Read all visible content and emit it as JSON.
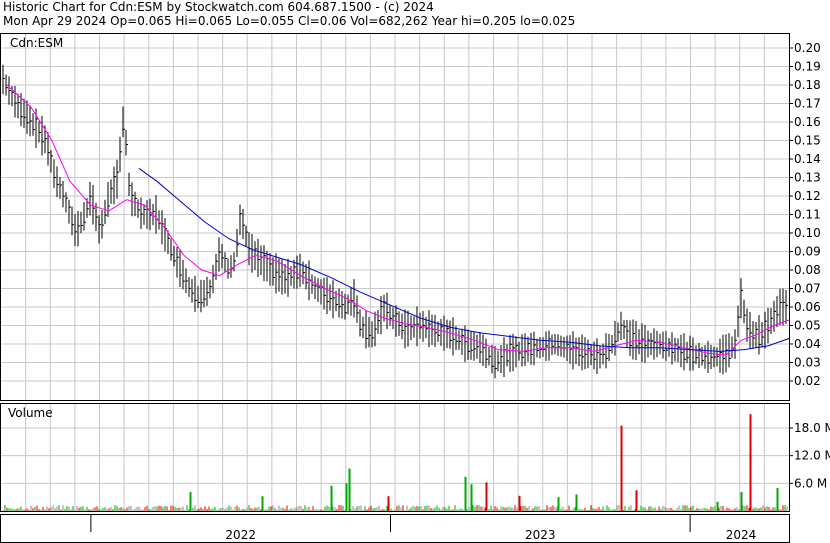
{
  "header": {
    "line1": "Historic Chart for Cdn:ESM by Stockwatch.com 604.687.1500 - (c) 2024",
    "line2": "Mon Apr 29 2024   Op=0.065   Hi=0.065   Lo=0.055   Cl=0.06   Vol=682,262   Year hi=0.205   lo=0.025"
  },
  "colors": {
    "price_bar": "#000000",
    "ma_short": "#ff00ff",
    "ma_long": "#0000cc",
    "volume_up": "#00aa00",
    "volume_down": "#dd0000",
    "volume_flat": "#888888",
    "grid": "#c8c8c8"
  },
  "chart_data": [
    {
      "type": "ohlc",
      "label": "Cdn:ESM",
      "y_ticks": [
        "0.20",
        "0.19",
        "0.18",
        "0.17",
        "0.16",
        "0.15",
        "0.14",
        "0.13",
        "0.12",
        "0.11",
        "0.10",
        "0.09",
        "0.08",
        "0.07",
        "0.06",
        "0.05",
        "0.04",
        "0.03",
        "0.02"
      ],
      "ylim": [
        0.01,
        0.205
      ],
      "x_ticks": [
        "2022",
        "2023",
        "2024"
      ],
      "x_tick_positions": [
        2022.5,
        2023.5,
        2024.17
      ],
      "xlim": [
        2021.7,
        2024.33
      ],
      "price_points": [
        [
          2021.7,
          0.185
        ],
        [
          2021.75,
          0.17
        ],
        [
          2021.8,
          0.16
        ],
        [
          2021.85,
          0.15
        ],
        [
          2021.88,
          0.13
        ],
        [
          2021.91,
          0.12
        ],
        [
          2021.95,
          0.1
        ],
        [
          2021.98,
          0.11
        ],
        [
          2022.0,
          0.12
        ],
        [
          2022.03,
          0.1
        ],
        [
          2022.06,
          0.12
        ],
        [
          2022.09,
          0.13
        ],
        [
          2022.11,
          0.165
        ],
        [
          2022.13,
          0.12
        ],
        [
          2022.17,
          0.11
        ],
        [
          2022.22,
          0.11
        ],
        [
          2022.27,
          0.09
        ],
        [
          2022.3,
          0.08
        ],
        [
          2022.33,
          0.07
        ],
        [
          2022.36,
          0.065
        ],
        [
          2022.4,
          0.07
        ],
        [
          2022.43,
          0.09
        ],
        [
          2022.46,
          0.08
        ],
        [
          2022.48,
          0.085
        ],
        [
          2022.5,
          0.11
        ],
        [
          2022.53,
          0.09
        ],
        [
          2022.57,
          0.085
        ],
        [
          2022.6,
          0.08
        ],
        [
          2022.65,
          0.075
        ],
        [
          2022.7,
          0.08
        ],
        [
          2022.75,
          0.07
        ],
        [
          2022.8,
          0.065
        ],
        [
          2022.85,
          0.06
        ],
        [
          2022.88,
          0.065
        ],
        [
          2022.9,
          0.05
        ],
        [
          2022.94,
          0.045
        ],
        [
          2022.98,
          0.06
        ],
        [
          2023.0,
          0.055
        ],
        [
          2023.05,
          0.048
        ],
        [
          2023.1,
          0.05
        ],
        [
          2023.15,
          0.047
        ],
        [
          2023.2,
          0.045
        ],
        [
          2023.25,
          0.04
        ],
        [
          2023.3,
          0.038
        ],
        [
          2023.35,
          0.03
        ],
        [
          2023.4,
          0.035
        ],
        [
          2023.45,
          0.037
        ],
        [
          2023.5,
          0.038
        ],
        [
          2023.55,
          0.04
        ],
        [
          2023.6,
          0.037
        ],
        [
          2023.65,
          0.035
        ],
        [
          2023.7,
          0.033
        ],
        [
          2023.74,
          0.04
        ],
        [
          2023.77,
          0.05
        ],
        [
          2023.8,
          0.043
        ],
        [
          2023.85,
          0.04
        ],
        [
          2023.9,
          0.04
        ],
        [
          2023.95,
          0.037
        ],
        [
          2024.0,
          0.035
        ],
        [
          2024.05,
          0.033
        ],
        [
          2024.09,
          0.033
        ],
        [
          2024.12,
          0.035
        ],
        [
          2024.15,
          0.04
        ],
        [
          2024.17,
          0.065
        ],
        [
          2024.19,
          0.05
        ],
        [
          2024.21,
          0.045
        ],
        [
          2024.24,
          0.045
        ],
        [
          2024.26,
          0.05
        ],
        [
          2024.28,
          0.055
        ],
        [
          2024.3,
          0.06
        ],
        [
          2024.33,
          0.06
        ]
      ],
      "series": [
        {
          "name": "short moving average",
          "points": [
            [
              2021.72,
              0.18
            ],
            [
              2021.8,
              0.168
            ],
            [
              2021.87,
              0.15
            ],
            [
              2021.93,
              0.128
            ],
            [
              2022.0,
              0.115
            ],
            [
              2022.06,
              0.112
            ],
            [
              2022.12,
              0.118
            ],
            [
              2022.18,
              0.115
            ],
            [
              2022.25,
              0.102
            ],
            [
              2022.31,
              0.088
            ],
            [
              2022.37,
              0.08
            ],
            [
              2022.43,
              0.077
            ],
            [
              2022.49,
              0.083
            ],
            [
              2022.55,
              0.088
            ],
            [
              2022.62,
              0.085
            ],
            [
              2022.7,
              0.077
            ],
            [
              2022.78,
              0.07
            ],
            [
              2022.85,
              0.065
            ],
            [
              2022.92,
              0.058
            ],
            [
              2022.98,
              0.054
            ],
            [
              2023.05,
              0.051
            ],
            [
              2023.12,
              0.049
            ],
            [
              2023.2,
              0.046
            ],
            [
              2023.28,
              0.042
            ],
            [
              2023.36,
              0.037
            ],
            [
              2023.44,
              0.036
            ],
            [
              2023.52,
              0.038
            ],
            [
              2023.6,
              0.038
            ],
            [
              2023.68,
              0.036
            ],
            [
              2023.75,
              0.039
            ],
            [
              2023.82,
              0.042
            ],
            [
              2023.9,
              0.041
            ],
            [
              2023.98,
              0.038
            ],
            [
              2024.06,
              0.035
            ],
            [
              2024.12,
              0.034
            ],
            [
              2024.17,
              0.042
            ],
            [
              2024.22,
              0.045
            ],
            [
              2024.28,
              0.05
            ],
            [
              2024.33,
              0.053
            ]
          ]
        },
        {
          "name": "long moving average",
          "points": [
            [
              2022.16,
              0.135
            ],
            [
              2022.22,
              0.128
            ],
            [
              2022.3,
              0.117
            ],
            [
              2022.38,
              0.106
            ],
            [
              2022.46,
              0.097
            ],
            [
              2022.54,
              0.091
            ],
            [
              2022.62,
              0.087
            ],
            [
              2022.7,
              0.083
            ],
            [
              2022.8,
              0.076
            ],
            [
              2022.9,
              0.068
            ],
            [
              2023.0,
              0.061
            ],
            [
              2023.1,
              0.054
            ],
            [
              2023.2,
              0.049
            ],
            [
              2023.3,
              0.046
            ],
            [
              2023.4,
              0.044
            ],
            [
              2023.5,
              0.042
            ],
            [
              2023.6,
              0.041
            ],
            [
              2023.7,
              0.039
            ],
            [
              2023.8,
              0.038
            ],
            [
              2023.9,
              0.038
            ],
            [
              2024.0,
              0.037
            ],
            [
              2024.1,
              0.036
            ],
            [
              2024.18,
              0.037
            ],
            [
              2024.26,
              0.039
            ],
            [
              2024.33,
              0.043
            ]
          ]
        }
      ]
    },
    {
      "type": "bar",
      "label": "Volume",
      "y_ticks": [
        "18.0 M",
        "12.0 M",
        "6.0 M"
      ],
      "ylim": [
        0,
        22
      ],
      "spikes": [
        {
          "x": 2022.33,
          "v": 4.1,
          "dir": "up"
        },
        {
          "x": 2022.57,
          "v": 3.2,
          "dir": "up"
        },
        {
          "x": 2022.8,
          "v": 5.5,
          "dir": "up"
        },
        {
          "x": 2022.85,
          "v": 6.0,
          "dir": "up"
        },
        {
          "x": 2022.86,
          "v": 9.2,
          "dir": "up"
        },
        {
          "x": 2022.99,
          "v": 3.2,
          "dir": "down"
        },
        {
          "x": 2023.25,
          "v": 7.4,
          "dir": "up"
        },
        {
          "x": 2023.27,
          "v": 5.8,
          "dir": "up"
        },
        {
          "x": 2023.32,
          "v": 6.2,
          "dir": "down"
        },
        {
          "x": 2023.43,
          "v": 3.3,
          "dir": "down"
        },
        {
          "x": 2023.56,
          "v": 3.0,
          "dir": "up"
        },
        {
          "x": 2023.62,
          "v": 3.6,
          "dir": "up"
        },
        {
          "x": 2023.77,
          "v": 18.5,
          "dir": "down"
        },
        {
          "x": 2023.82,
          "v": 4.5,
          "dir": "down"
        },
        {
          "x": 2024.09,
          "v": 2.0,
          "dir": "up"
        },
        {
          "x": 2024.17,
          "v": 4.1,
          "dir": "up"
        },
        {
          "x": 2024.2,
          "v": 21.0,
          "dir": "down"
        },
        {
          "x": 2024.29,
          "v": 5.0,
          "dir": "up"
        }
      ]
    }
  ]
}
